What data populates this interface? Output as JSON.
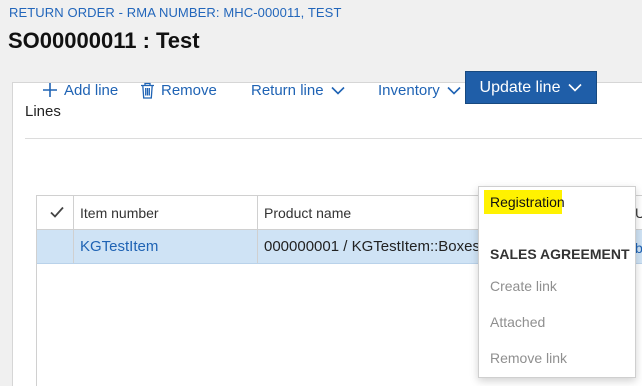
{
  "header": {
    "breadcrumb": "RETURN ORDER - RMA NUMBER: MHC-000011, TEST",
    "title": "SO00000011 : Test"
  },
  "lines_panel": {
    "title": "Lines"
  },
  "toolbar": {
    "add_line": "Add line",
    "remove": "Remove",
    "return_line": "Return line",
    "inventory": "Inventory",
    "update_line": "Update line"
  },
  "grid": {
    "columns": [
      "Item number",
      "Product name",
      "U"
    ],
    "rows": [
      {
        "item_number": "KGTestItem",
        "product_name": "000000001 / KGTestItem::Boxes",
        "peek": "b"
      }
    ]
  },
  "update_line_menu": {
    "registration": "Registration",
    "section_title": "SALES AGREEMENT",
    "create_link": "Create link",
    "attached": "Attached",
    "remove_link": "Remove link"
  },
  "colors": {
    "accent": "#1f5ea8",
    "link": "#1f63b4",
    "selected_row": "#cfe3f5",
    "highlight": "#fff200"
  },
  "icons": {
    "add": "plus-icon",
    "remove": "trash-icon",
    "dropdown": "chevron-down-icon",
    "select_all": "checkmark-icon"
  }
}
